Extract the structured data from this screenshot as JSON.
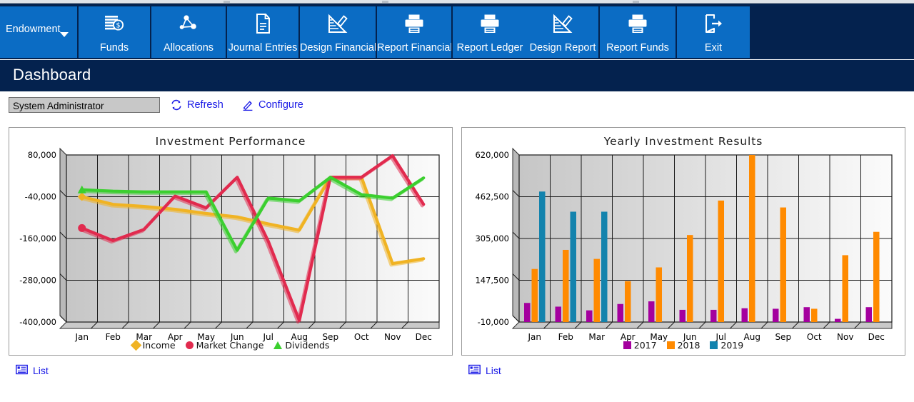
{
  "ribbon": {
    "buttons": [
      {
        "label": "Endowment",
        "icon": "chevron-down-icon",
        "type": "dropdown"
      },
      {
        "label": "Funds",
        "icon": "funds-money-icon",
        "type": "command"
      },
      {
        "label": "Allocations",
        "icon": "allocations-network-icon",
        "type": "command"
      },
      {
        "label": "Journal Entries",
        "icon": "document-icon",
        "type": "command"
      },
      {
        "label": "Design Financial",
        "icon": "design-ruler-pencil-icon",
        "type": "command"
      },
      {
        "label": "Report Financial",
        "icon": "printer-icon",
        "type": "command"
      },
      {
        "label": "Report Ledger",
        "icon": "printer-icon",
        "type": "command"
      },
      {
        "label": "Design Report",
        "icon": "design-ruler-pencil-icon",
        "type": "command"
      },
      {
        "label": "Report Funds",
        "icon": "printer-icon",
        "type": "command"
      },
      {
        "label": "Exit",
        "icon": "exit-door-icon",
        "type": "command"
      }
    ]
  },
  "page": {
    "title": "Dashboard"
  },
  "actions": {
    "role_value": "System Administrator",
    "role_placeholder": "System Administrator",
    "refresh_label": "Refresh",
    "refresh_icon": "refresh-icon",
    "configure_label": "Configure",
    "configure_icon": "pencil-icon"
  },
  "panels": {
    "left": {
      "list_label": "List",
      "list_icon": "list-icon"
    },
    "right": {
      "list_label": "List",
      "list_icon": "list-icon"
    }
  },
  "colors": {
    "ribbon_bg": "#04224e",
    "button_blue": "#0b6cc4",
    "link_blue": "#1a1ae6",
    "income_yellow": "#f0b323",
    "market_red": "#e12a4e",
    "dividends_green": "#3bcf2f",
    "year_2017_purple": "#a4009e",
    "year_2018_orange": "#ff8a00",
    "year_2019_teal": "#1383ad"
  },
  "chart_data": [
    {
      "type": "line",
      "title": "Investment Performance",
      "xlabel": "",
      "ylabel": "",
      "grid": true,
      "legend_position": "bottom",
      "categories": [
        "Jan",
        "Feb",
        "Mar",
        "Apr",
        "May",
        "Jun",
        "Jul",
        "Aug",
        "Sep",
        "Oct",
        "Nov",
        "Dec"
      ],
      "ylim": [
        -400000,
        80000
      ],
      "yticks": [
        80000,
        -40000,
        -160000,
        -280000,
        -400000
      ],
      "ytick_labels": [
        "80,000",
        "-40,000",
        "-160,000",
        "-280,000",
        "-400,000"
      ],
      "series": [
        {
          "name": "Income",
          "color": "#f0b323",
          "marker": "diamond",
          "values": [
            -40000,
            -62000,
            -68000,
            -76000,
            -88000,
            -98000,
            -118000,
            -136000,
            16000,
            16000,
            -232000,
            -218000
          ]
        },
        {
          "name": "Market Change",
          "color": "#e12a4e",
          "marker": "circle",
          "values": [
            -130000,
            -166000,
            -134000,
            -38000,
            -72000,
            16000,
            -168000,
            -396000,
            16000,
            16000,
            78000,
            -62000
          ]
        },
        {
          "name": "Dividends",
          "color": "#3bcf2f",
          "marker": "triangle",
          "values": [
            -20000,
            -24000,
            -26000,
            -26000,
            -26000,
            -194000,
            -44000,
            -52000,
            16000,
            -34000,
            -44000,
            14000
          ]
        }
      ]
    },
    {
      "type": "bar",
      "title": "Yearly Investment Results",
      "xlabel": "",
      "ylabel": "",
      "grid": true,
      "legend_position": "bottom",
      "categories": [
        "Jan",
        "Feb",
        "Mar",
        "Apr",
        "May",
        "Jun",
        "Jul",
        "Aug",
        "Sep",
        "Oct",
        "Nov",
        "Dec"
      ],
      "ylim": [
        -10000,
        620000
      ],
      "yticks": [
        620000,
        462500,
        305000,
        147500,
        -10000
      ],
      "ytick_labels": [
        "620,000",
        "462,500",
        "305,000",
        "147,500",
        "-10,000"
      ],
      "series": [
        {
          "name": "2017",
          "color": "#a4009e",
          "values": [
            62000,
            48000,
            34000,
            58000,
            68000,
            36000,
            36000,
            42000,
            40000,
            46000,
            2000,
            46000
          ]
        },
        {
          "name": "2018",
          "color": "#ff8a00",
          "values": [
            190000,
            262000,
            228000,
            144000,
            196000,
            318000,
            448000,
            620000,
            422000,
            40000,
            242000,
            330000
          ]
        },
        {
          "name": "2019",
          "color": "#1383ad",
          "values": [
            482000,
            406000,
            406000,
            0,
            0,
            0,
            0,
            0,
            0,
            0,
            0,
            0
          ]
        }
      ]
    }
  ]
}
